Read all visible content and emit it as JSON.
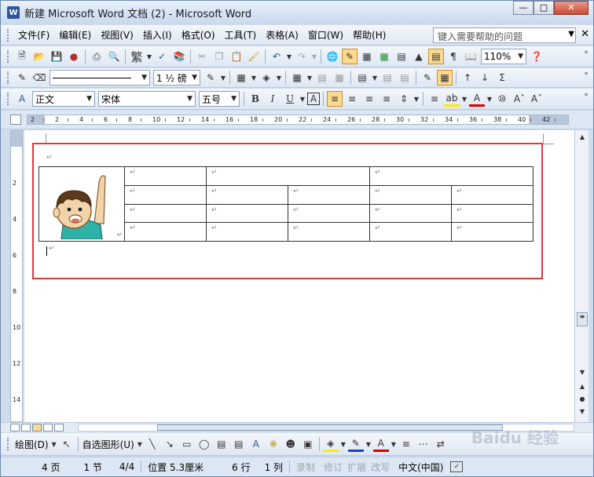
{
  "window": {
    "title": "新建 Microsoft Word 文档 (2) - Microsoft Word",
    "app_icon_text": "W"
  },
  "menu": {
    "items": [
      {
        "label": "文件(F)"
      },
      {
        "label": "编辑(E)"
      },
      {
        "label": "视图(V)"
      },
      {
        "label": "插入(I)"
      },
      {
        "label": "格式(O)"
      },
      {
        "label": "工具(T)"
      },
      {
        "label": "表格(A)"
      },
      {
        "label": "窗口(W)"
      },
      {
        "label": "帮助(H)"
      }
    ],
    "help_placeholder": "键入需要帮助的问题"
  },
  "toolbar_standard": {
    "traditional_chinese": "繁",
    "zoom": "110%"
  },
  "toolbar_tables": {
    "line_weight": "1 ½ 磅"
  },
  "toolbar_format": {
    "style": "正文",
    "font": "宋体",
    "font_size": "五号",
    "bold": "B",
    "italic": "I",
    "underline": "U",
    "char_border": "A"
  },
  "ruler": {
    "labels": [
      "2",
      "2",
      "4",
      "6",
      "8",
      "10",
      "12",
      "14",
      "16",
      "18",
      "20",
      "22",
      "24",
      "26",
      "28",
      "30",
      "32",
      "34",
      "36",
      "38",
      "40",
      "42"
    ],
    "v_labels": [
      "2",
      "4",
      "6",
      "8",
      "10",
      "12",
      "14"
    ]
  },
  "document": {
    "para_mark": "↵",
    "table_rows": 4
  },
  "drawing": {
    "draw_label": "绘图(D)",
    "autoshape_label": "自选图形(U)"
  },
  "status": {
    "page": "4 页",
    "section": "1 节",
    "pages": "4/4",
    "position": "位置 5.3厘米",
    "line": "6 行",
    "column": "1 列",
    "rec": "录制",
    "trk": "修订",
    "ext": "扩展",
    "ovr": "改写",
    "language": "中文(中国)"
  },
  "watermark": "Baidu 经验"
}
